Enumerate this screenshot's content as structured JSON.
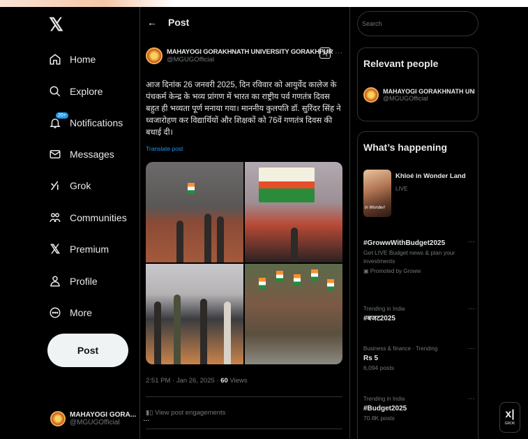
{
  "nav": {
    "items": [
      {
        "label": "Home",
        "icon": "home-icon"
      },
      {
        "label": "Explore",
        "icon": "search-icon"
      },
      {
        "label": "Notifications",
        "icon": "bell-icon",
        "badge": "20+"
      },
      {
        "label": "Messages",
        "icon": "envelope-icon"
      },
      {
        "label": "Grok",
        "icon": "grok-icon"
      },
      {
        "label": "Communities",
        "icon": "people-icon"
      },
      {
        "label": "Premium",
        "icon": "x-logo-icon"
      },
      {
        "label": "Profile",
        "icon": "person-icon"
      },
      {
        "label": "More",
        "icon": "more-circle-icon"
      }
    ],
    "post_label": "Post",
    "account": {
      "name": "MAHAYOGI GORA...",
      "handle": "@MGUGOfficial",
      "more": "..."
    }
  },
  "main": {
    "back": "←",
    "title": "Post",
    "author": {
      "name": "MAHAYOGI GORAKHNATH UNIVERSITY GORAKHPUR",
      "handle": "@MGUGOfficial",
      "more": "···"
    },
    "text": "आज दिनांक 26 जनवरी 2025, दिन रविवार को आयुर्वेद कालेज के पंचकर्म केन्द्र के भव्य प्रांगण में भारत का राष्ट्रीय पर्व गणतंत्र दिवस बहुत ही भव्यता पूर्ण मनाया गया। माननीय कुलपति डॉ. सुरिंदर सिंह ने ध्वजारोहण कर विद्यार्थियों और शिक्षकों को 76वें गणतंत्र दिवस की बधाई दी।",
    "translate": "Translate post",
    "meta_time": "2:51 PM · Jan 26, 2025 · ",
    "meta_views": "60",
    "meta_views_label": " Views",
    "engagements": "View post engagements"
  },
  "right": {
    "search_placeholder": "Search",
    "relevant_title": "Relevant people",
    "relevant": {
      "name": "MAHAYOGI GORAKHNATH UNIVER...",
      "handle": "@MGUGOfficial"
    },
    "happening_title": "What’s happening",
    "live": {
      "title": "Khloé in Wonder Land",
      "sub": "LIVE",
      "caption": "in Wonderl"
    },
    "trends": [
      {
        "small": "",
        "name": "#GrowwWithBudget2025",
        "desc": "Get LIVE Budget news & plan your investments",
        "promo": "Promoted by Groww"
      },
      {
        "small": "Trending in India",
        "name": "#बजट2025",
        "desc": "",
        "promo": ""
      },
      {
        "small": "Business & finance · Trending",
        "name": "Rs 5",
        "desc": "6,094 posts",
        "promo": ""
      },
      {
        "small": "Trending in India",
        "name": "#Budget2025",
        "desc": "70.8K posts",
        "promo": ""
      }
    ],
    "more": "···"
  },
  "grok_float": {
    "label": "GROK"
  }
}
